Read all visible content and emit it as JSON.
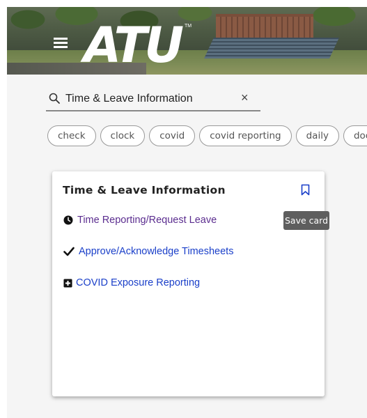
{
  "header": {
    "logo_text": "ATU",
    "logo_tm": "TM"
  },
  "search": {
    "query": "Time & Leave Information",
    "clear_symbol": "×"
  },
  "chips": [
    "check",
    "clock",
    "covid",
    "covid reporting",
    "daily",
    "docu"
  ],
  "card": {
    "title": "Time & Leave Information",
    "links": [
      {
        "label": "Time Reporting/Request Leave",
        "icon": "clock-icon"
      },
      {
        "label": "Approve/Acknowledge Timesheets",
        "icon": "checkmark-icon"
      },
      {
        "label": "COVID Exposure Reporting",
        "icon": "plus-square-icon"
      }
    ],
    "bookmark_icon": "bookmark-icon"
  },
  "tooltip": {
    "text": "Save card"
  },
  "colors": {
    "visited_link": "#5b2d8f",
    "link": "#1a3fc9",
    "bookmark": "#1a3fc9",
    "tooltip_bg": "#5e5e5e"
  }
}
